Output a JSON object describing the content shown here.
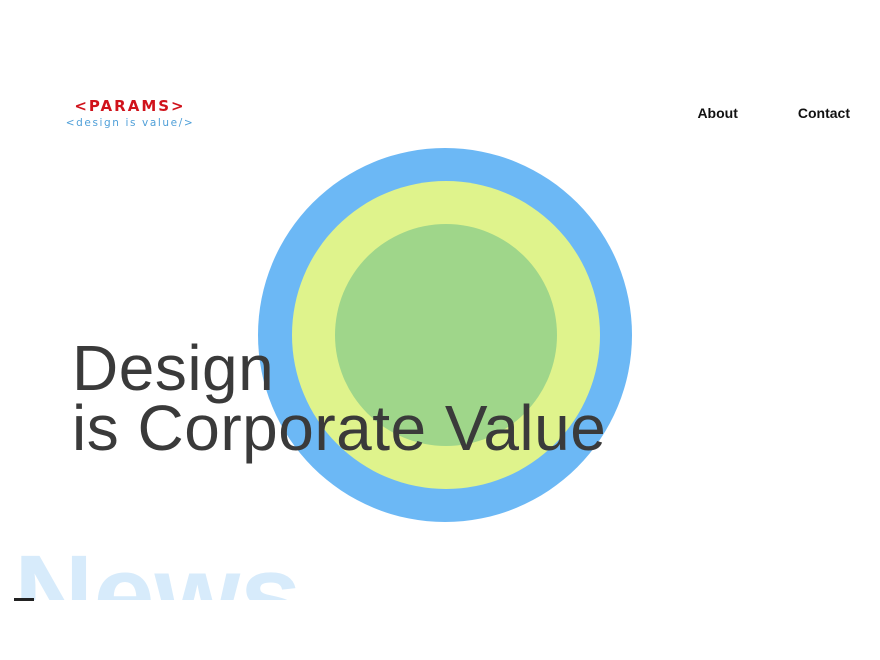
{
  "logo": {
    "name": "<PARAMS>",
    "tagline": "<design is value/>"
  },
  "nav": {
    "items": [
      {
        "label": "About"
      },
      {
        "label": "Contact"
      }
    ]
  },
  "hero": {
    "line1": "Design",
    "line2": "is Corporate Value"
  },
  "news": {
    "background_title": "News"
  },
  "colors": {
    "brand_red": "#d0121b",
    "tagline_blue": "#4f9fd8",
    "ring_outer": "#6cb8f5",
    "ring_middle": "#dff38c",
    "ring_inner": "#9fd68a",
    "news_watermark": "#d7ebfb"
  }
}
